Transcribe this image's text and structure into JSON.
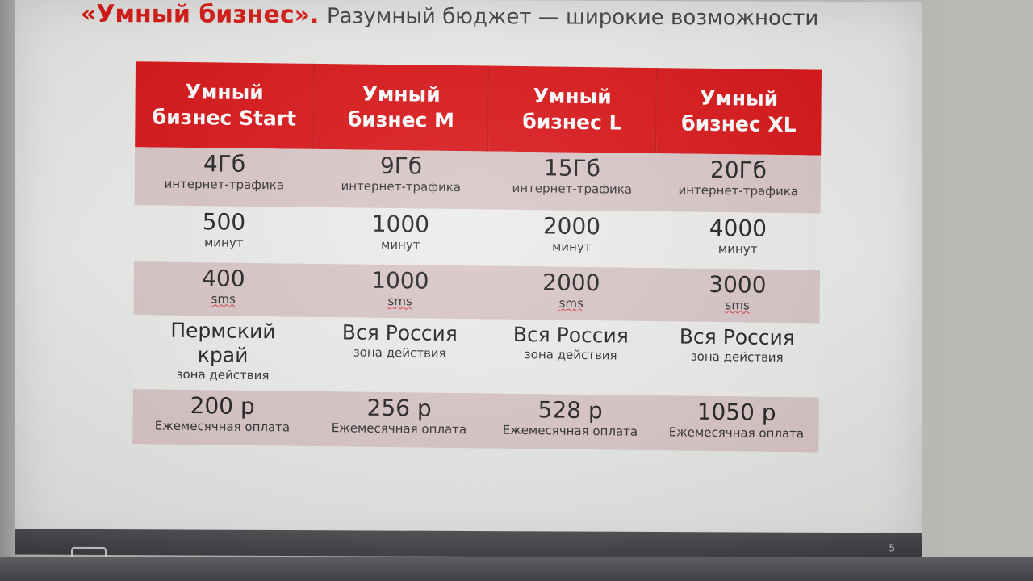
{
  "title": {
    "brand": "«Умный бизнес».",
    "subtitle": "Разумный бюджет — широкие возможности"
  },
  "plans": {
    "headers": [
      "Умный\nбизнес Start",
      "Умный\nбизнес M",
      "Умный\nбизнес L",
      "Умный\nбизнес XL"
    ],
    "traffic": {
      "values": [
        "4Гб",
        "9Гб",
        "15Гб",
        "20Гб"
      ],
      "unit": "интернет-трафика"
    },
    "minutes": {
      "values": [
        "500",
        "1000",
        "2000",
        "4000"
      ],
      "unit": "минут"
    },
    "sms": {
      "values": [
        "400",
        "1000",
        "2000",
        "3000"
      ],
      "unit": "sms"
    },
    "zone": {
      "values": [
        "Пермский край",
        "Вся Россия",
        "Вся Россия",
        "Вся Россия"
      ],
      "unit": "зона действия"
    },
    "price": {
      "values": [
        "200 р",
        "256 р",
        "528 р",
        "1050 р"
      ],
      "unit": "Ежемесячная оплата"
    }
  },
  "footer": {
    "page_number": "5"
  },
  "colors": {
    "brand_red": "#d80d10",
    "row_shade": "#d8c4c6",
    "row_plain": "#ebebe9"
  }
}
